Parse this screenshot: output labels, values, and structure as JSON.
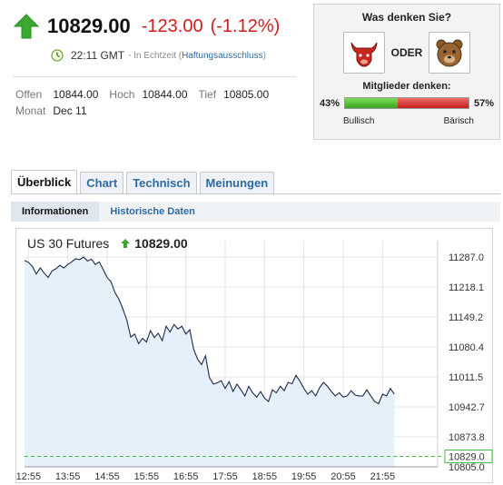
{
  "quote": {
    "price": "10829.00",
    "change": "-123.00",
    "change_pct": "(-1.12%)",
    "time": "22:11 GMT",
    "realtime": "- In Echtzeit",
    "disclaimer_open": "(",
    "disclaimer": "Haftungsausschluss",
    "disclaimer_close": ")",
    "arrow_color": "#3aa832",
    "change_color": "#d61b1b"
  },
  "stats": {
    "open_label": "Offen",
    "open_value": "10844.00",
    "high_label": "Hoch",
    "high_value": "10844.00",
    "low_label": "Tief",
    "low_value": "10805.00",
    "month_label": "Monat",
    "month_value": "Dec 11"
  },
  "sentiment": {
    "question": "Was denken Sie?",
    "or_label": "ODER",
    "bull_icon": "bull-icon",
    "bear_icon": "bear-icon",
    "members_label": "Mitglieder denken:",
    "bull_pct_label": "43%",
    "bear_pct_label": "57%",
    "bull_fraction": 0.43,
    "bull_label": "Bullisch",
    "bear_label": "Bärisch"
  },
  "tabs": [
    "Überblick",
    "Chart",
    "Technisch",
    "Meinungen"
  ],
  "subtabs": [
    "Informationen",
    "Historische Daten"
  ],
  "chart_data": {
    "type": "line",
    "title": "US 30 Futures",
    "last_value": "10829.00",
    "y_ticks": [
      "11287.0",
      "11218.1",
      "11149.2",
      "11080.4",
      "11011.5",
      "10942.7",
      "10873.8",
      "10805.0"
    ],
    "current_label": "10829.0",
    "x_ticks": [
      "12:55",
      "13:55",
      "14:55",
      "15:55",
      "16:55",
      "17:55",
      "18:55",
      "19:55",
      "20:55",
      "21:55"
    ],
    "ylim": [
      10805.0,
      11287.0
    ],
    "x": [
      0.0,
      0.1,
      0.2,
      0.3,
      0.4,
      0.5,
      0.6,
      0.7,
      0.8,
      0.9,
      1.0,
      1.1,
      1.2,
      1.3,
      1.4,
      1.5,
      1.6,
      1.7,
      1.8,
      1.9,
      2.0,
      2.1,
      2.2,
      2.3,
      2.4,
      2.5,
      2.6,
      2.7,
      2.8,
      2.9,
      3.0,
      3.1,
      3.2,
      3.3,
      3.4,
      3.5,
      3.6,
      3.7,
      3.8,
      3.9,
      4.0,
      4.1,
      4.2,
      4.3,
      4.4,
      4.5,
      4.6,
      4.7,
      4.8,
      4.9,
      5.0,
      5.1,
      5.2,
      5.3,
      5.4,
      5.5,
      5.6,
      5.7,
      5.8,
      5.9,
      6.0,
      6.1,
      6.2,
      6.3,
      6.4,
      6.5,
      6.6,
      6.7,
      6.8,
      6.9,
      7.0,
      7.1,
      7.2,
      7.3,
      7.4,
      7.5,
      7.6,
      7.7,
      7.8,
      7.9,
      8.0,
      8.1,
      8.2,
      8.3,
      8.4,
      8.5,
      8.6,
      8.7,
      8.8,
      8.9,
      9.0,
      9.1,
      9.2,
      9.3,
      9.4
    ],
    "values": [
      11279,
      11275,
      11265,
      11248,
      11262,
      11250,
      11240,
      11255,
      11260,
      11268,
      11262,
      11270,
      11276,
      11283,
      11281,
      11287,
      11278,
      11282,
      11270,
      11276,
      11258,
      11240,
      11230,
      11205,
      11190,
      11168,
      11142,
      11103,
      11110,
      11088,
      11100,
      11092,
      11118,
      11102,
      11112,
      11095,
      11128,
      11115,
      11132,
      11122,
      11128,
      11110,
      11120,
      11075,
      11052,
      11040,
      11060,
      11010,
      10995,
      10998,
      11003,
      10985,
      11001,
      10978,
      10995,
      10982,
      10968,
      10990,
      10975,
      10965,
      10978,
      10963,
      10955,
      10982,
      10975,
      10990,
      10980,
      10999,
      10996,
      11015,
      11002,
      10985,
      10972,
      10980,
      10968,
      10987,
      10999,
      10990,
      10978,
      10968,
      10975,
      10965,
      10968,
      10980,
      10970,
      10968,
      10968,
      10982,
      10968,
      10955,
      10950,
      10972,
      10968,
      10985,
      10972
    ]
  }
}
